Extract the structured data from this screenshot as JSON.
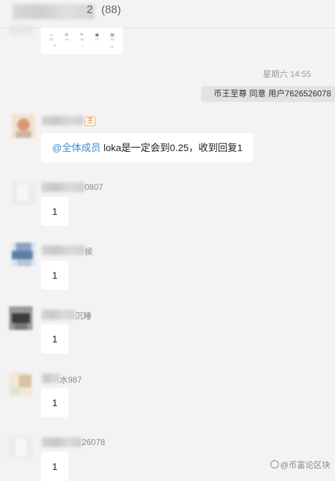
{
  "header": {
    "title_suffix": "2",
    "member_count": "(88)"
  },
  "shared_card": {
    "items": [
      {
        "icon": "⌂",
        "label": "首页"
      },
      {
        "icon": "ılı",
        "label": "行情"
      },
      {
        "icon": "✎",
        "label": "交易"
      },
      {
        "icon": "▣",
        "label": "资产"
      },
      {
        "icon": "▤",
        "label": "我的"
      }
    ],
    "nav": [
      "≡",
      "○",
      "⊐"
    ]
  },
  "conversation": {
    "timestamp": "星期六 14:55",
    "system_message": "币王至尊 同意 用户7626526078 ",
    "messages": [
      {
        "name_tail": "",
        "tag": "主",
        "text_mention": "@全体成员",
        "text": " loka是一定会到0.25，收到回复1"
      },
      {
        "name_tail": "0807",
        "text": "1"
      },
      {
        "name_tail": "侯",
        "text": "1"
      },
      {
        "name_tail": "沉睡",
        "text": "1"
      },
      {
        "name_tail": "水987",
        "text": "1"
      },
      {
        "name_tail": "26078",
        "text": "1"
      }
    ]
  },
  "watermark": "@币富论区块"
}
